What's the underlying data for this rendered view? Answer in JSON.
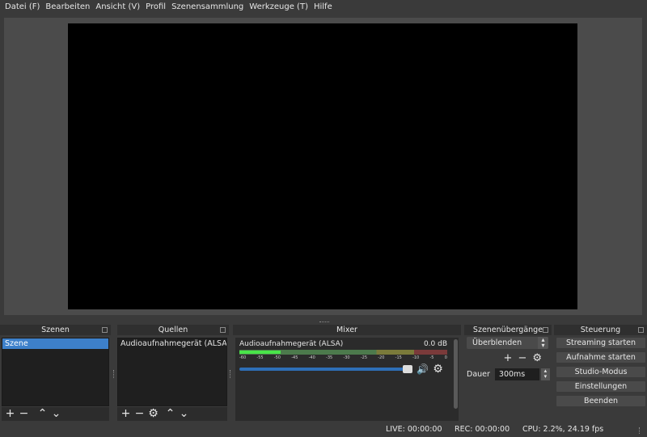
{
  "menu": {
    "items": [
      "Datei (F)",
      "Bearbeiten",
      "Ansicht (V)",
      "Profil",
      "Szenensammlung",
      "Werkzeuge (T)",
      "Hilfe"
    ]
  },
  "scenes": {
    "title": "Szenen",
    "items": [
      "Szene"
    ]
  },
  "sources": {
    "title": "Quellen",
    "items": [
      "Audioaufnahmegerät (ALSA)"
    ]
  },
  "mixer": {
    "title": "Mixer",
    "channel": {
      "name": "Audioaufnahmegerät (ALSA)",
      "level": "0.0 dB",
      "meter_fraction": 0.2,
      "volume_fraction": 1.0,
      "ticks": [
        "-60",
        "-55",
        "-50",
        "-45",
        "-40",
        "-35",
        "-30",
        "-25",
        "-20",
        "-15",
        "-10",
        "-5",
        "0"
      ]
    }
  },
  "transitions": {
    "title": "Szenenübergänge",
    "selected": "Überblenden",
    "duration_label": "Dauer",
    "duration_value": "300ms"
  },
  "controls": {
    "title": "Steuerung",
    "buttons": [
      "Streaming starten",
      "Aufnahme starten",
      "Studio-Modus",
      "Einstellungen",
      "Beenden"
    ]
  },
  "status": {
    "live": "LIVE: 00:00:00",
    "rec": "REC: 00:00:00",
    "cpu": "CPU: 2.2%, 24.19 fps"
  },
  "colors": {
    "selection": "#3d80ca",
    "meter_active": "#49e449",
    "volume_slider": "#2e6fb7"
  },
  "icons": {
    "add": "+",
    "remove": "−",
    "up": "⌃",
    "down": "⌄",
    "gear": "⚙",
    "speaker": "🔊"
  }
}
